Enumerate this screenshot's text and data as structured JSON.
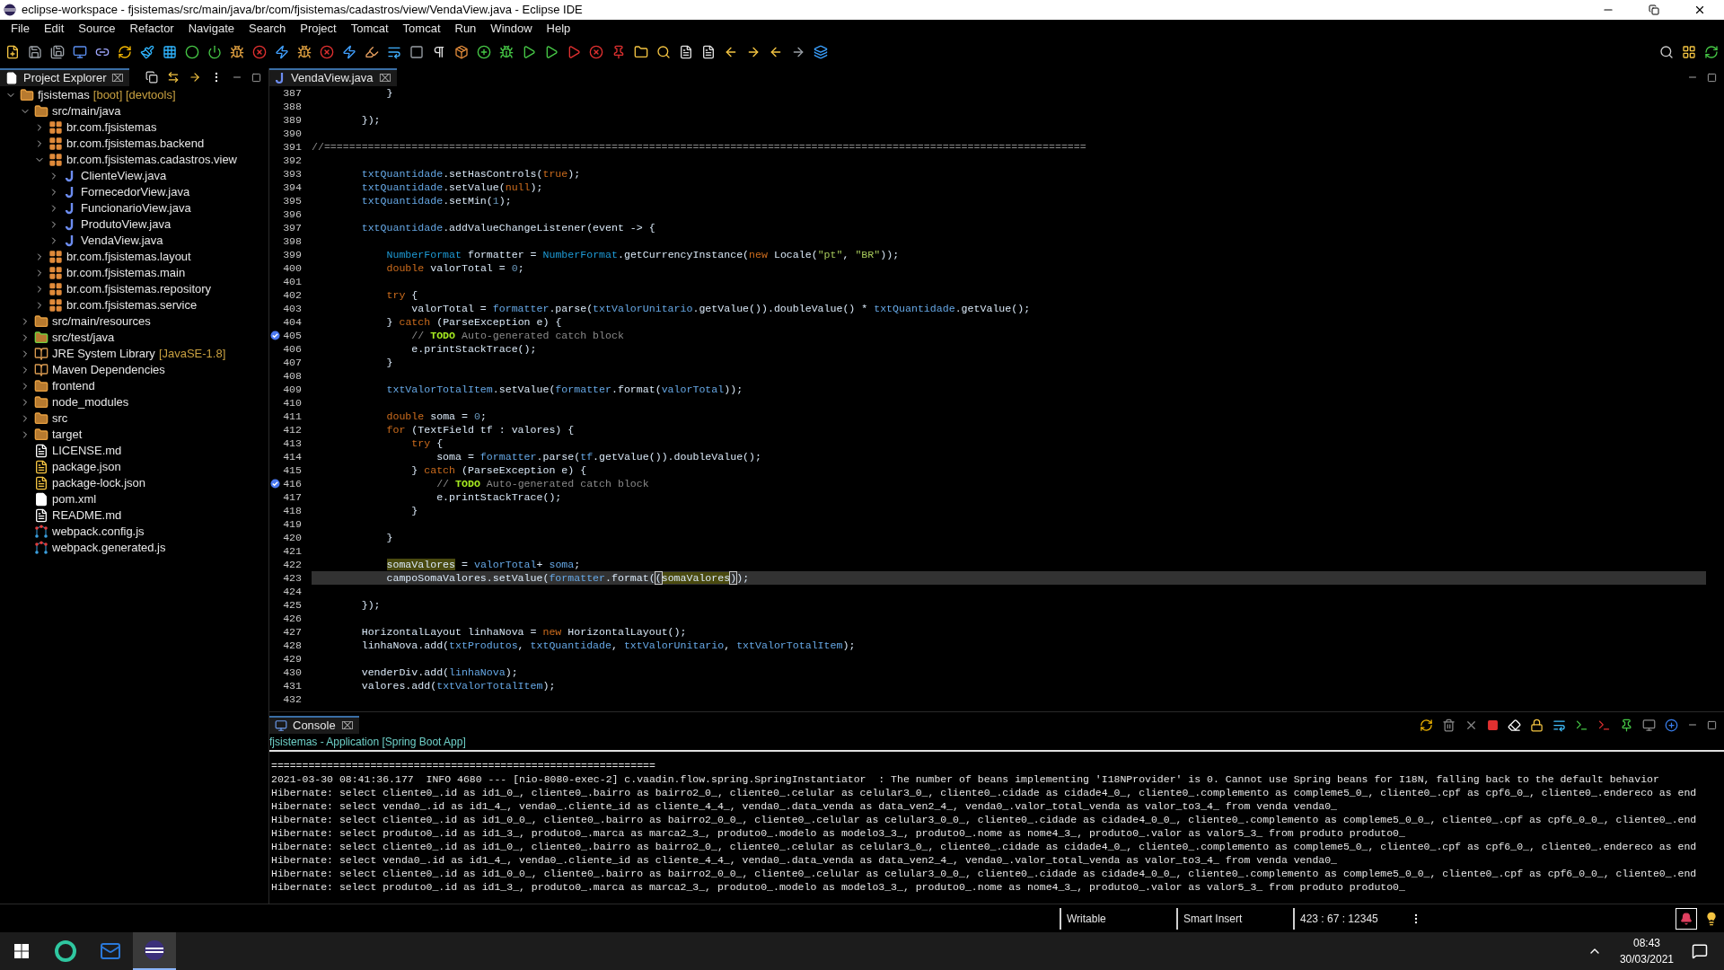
{
  "window": {
    "title": "eclipse-workspace - fjsistemas/src/main/java/br/com/fjsistemas/cadastros/view/VendaView.java - Eclipse IDE"
  },
  "menu": [
    "File",
    "Edit",
    "Source",
    "Refactor",
    "Navigate",
    "Search",
    "Project",
    "Tomcat",
    "Tomcat",
    "Run",
    "Window",
    "Help"
  ],
  "project_explorer": {
    "tab": {
      "label": "Project Explorer",
      "selected": true,
      "close": "⌧"
    },
    "tree": [
      {
        "kind": "project",
        "label": "fjsistemas",
        "decoration": "[boot] [devtools]",
        "expanded": true,
        "children": [
          {
            "kind": "source-folder",
            "label": "src/main/java",
            "expanded": true,
            "children": [
              {
                "kind": "package",
                "label": "br.com.fjsistemas",
                "expanded": false
              },
              {
                "kind": "package",
                "label": "br.com.fjsistemas.backend",
                "expanded": false
              },
              {
                "kind": "package",
                "label": "br.com.fjsistemas.cadastros.view",
                "expanded": true,
                "children": [
                  {
                    "kind": "java",
                    "label": "ClienteView.java",
                    "expanded": false
                  },
                  {
                    "kind": "java",
                    "label": "FornecedorView.java",
                    "expanded": false
                  },
                  {
                    "kind": "java",
                    "label": "FuncionarioView.java",
                    "expanded": false
                  },
                  {
                    "kind": "java",
                    "label": "ProdutoView.java",
                    "expanded": false
                  },
                  {
                    "kind": "java",
                    "label": "VendaView.java",
                    "expanded": false
                  }
                ]
              },
              {
                "kind": "package",
                "label": "br.com.fjsistemas.layout",
                "expanded": false
              },
              {
                "kind": "package",
                "label": "br.com.fjsistemas.main",
                "expanded": false
              },
              {
                "kind": "package",
                "label": "br.com.fjsistemas.repository",
                "expanded": false
              },
              {
                "kind": "package",
                "label": "br.com.fjsistemas.service",
                "expanded": false
              }
            ]
          },
          {
            "kind": "source-folder",
            "label": "src/main/resources",
            "expanded": false
          },
          {
            "kind": "test-folder",
            "label": "src/test/java",
            "expanded": false
          },
          {
            "kind": "library",
            "label": "JRE System Library",
            "decoration": "[JavaSE-1.8]",
            "expanded": false
          },
          {
            "kind": "library",
            "label": "Maven Dependencies",
            "expanded": false
          },
          {
            "kind": "folder",
            "label": "frontend",
            "expanded": false
          },
          {
            "kind": "folder",
            "label": "node_modules",
            "expanded": false
          },
          {
            "kind": "folder",
            "label": "src",
            "expanded": false
          },
          {
            "kind": "folder",
            "label": "target",
            "expanded": false
          },
          {
            "kind": "file",
            "label": "LICENSE.md"
          },
          {
            "kind": "json",
            "label": "package.json"
          },
          {
            "kind": "json",
            "label": "package-lock.json"
          },
          {
            "kind": "pom",
            "label": "pom.xml"
          },
          {
            "kind": "file",
            "label": "README.md"
          },
          {
            "kind": "webpack",
            "label": "webpack.config.js"
          },
          {
            "kind": "webpack",
            "label": "webpack.generated.js"
          }
        ]
      }
    ]
  },
  "editor": {
    "tab": {
      "label": "VendaView.java",
      "selected": true,
      "close": "⌧"
    },
    "lines": [
      {
        "number": "387",
        "kind": "code",
        "segments": [
          {
            "kind": "plain",
            "text": "            }"
          }
        ]
      },
      {
        "number": "388",
        "kind": "code"
      },
      {
        "number": "389",
        "kind": "code",
        "segments": [
          {
            "kind": "plain",
            "text": "        });"
          }
        ]
      },
      {
        "number": "390",
        "kind": "code"
      },
      {
        "number": "391",
        "kind": "code",
        "segments": [
          {
            "kind": "comment",
            "text": "//=========================================================================================================================="
          }
        ]
      },
      {
        "number": "392",
        "kind": "code"
      },
      {
        "number": "393",
        "kind": "code",
        "segments": [
          {
            "kind": "field",
            "text": "        txtQuantidade"
          },
          {
            "kind": "plain",
            "text": ".setHasControls("
          },
          {
            "kind": "keyword",
            "text": "true"
          },
          {
            "kind": "plain",
            "text": ");"
          }
        ]
      },
      {
        "number": "394",
        "kind": "code",
        "segments": [
          {
            "kind": "field",
            "text": "        txtQuantidade"
          },
          {
            "kind": "plain",
            "text": ".setValue("
          },
          {
            "kind": "keyword",
            "text": "null"
          },
          {
            "kind": "plain",
            "text": ");"
          }
        ]
      },
      {
        "number": "395",
        "kind": "code",
        "segments": [
          {
            "kind": "field",
            "text": "        txtQuantidade"
          },
          {
            "kind": "plain",
            "text": ".setMin("
          },
          {
            "kind": "number",
            "text": "1"
          },
          {
            "kind": "plain",
            "text": ");"
          }
        ]
      },
      {
        "number": "396",
        "kind": "code"
      },
      {
        "number": "397",
        "kind": "code",
        "segments": [
          {
            "kind": "field",
            "text": "        txtQuantidade"
          },
          {
            "kind": "plain",
            "text": ".addValueChangeListener(event -> {"
          }
        ]
      },
      {
        "number": "398",
        "kind": "code"
      },
      {
        "number": "399",
        "kind": "code",
        "segments": [
          {
            "kind": "type",
            "text": "            NumberFormat"
          },
          {
            "kind": "plain",
            "text": " formatter = "
          },
          {
            "kind": "type",
            "text": "NumberFormat"
          },
          {
            "kind": "plain",
            "text": ".getCurrencyInstance("
          },
          {
            "kind": "keyword",
            "text": "new"
          },
          {
            "kind": "plain",
            "text": " Locale("
          },
          {
            "kind": "string",
            "text": "\"pt\""
          },
          {
            "kind": "plain",
            "text": ", "
          },
          {
            "kind": "string",
            "text": "\"BR\""
          },
          {
            "kind": "plain",
            "text": "));"
          }
        ]
      },
      {
        "number": "400",
        "kind": "code",
        "segments": [
          {
            "kind": "keyword",
            "text": "            double"
          },
          {
            "kind": "plain",
            "text": " valorTotal = "
          },
          {
            "kind": "number",
            "text": "0"
          },
          {
            "kind": "plain",
            "text": ";"
          }
        ]
      },
      {
        "number": "401",
        "kind": "code"
      },
      {
        "number": "402",
        "kind": "code",
        "segments": [
          {
            "kind": "keyword",
            "text": "            try"
          },
          {
            "kind": "plain",
            "text": " {"
          }
        ]
      },
      {
        "number": "403",
        "kind": "code",
        "segments": [
          {
            "kind": "plain",
            "text": "                valorTotal = "
          },
          {
            "kind": "field",
            "text": "formatter"
          },
          {
            "kind": "plain",
            "text": ".parse("
          },
          {
            "kind": "field",
            "text": "txtValorUnitario"
          },
          {
            "kind": "plain",
            "text": ".getValue()).doubleValue() * "
          },
          {
            "kind": "field",
            "text": "txtQuantidade"
          },
          {
            "kind": "plain",
            "text": ".getValue();"
          }
        ]
      },
      {
        "number": "404",
        "kind": "code",
        "segments": [
          {
            "kind": "plain",
            "text": "            } "
          },
          {
            "kind": "keyword",
            "text": "catch"
          },
          {
            "kind": "plain",
            "text": " (ParseException e) {"
          }
        ]
      },
      {
        "number": "405",
        "kind": "task",
        "segments": [
          {
            "kind": "comment",
            "text": "                // "
          },
          {
            "kind": "todo",
            "text": "TODO"
          },
          {
            "kind": "comment",
            "text": " Auto-generated catch block"
          }
        ]
      },
      {
        "number": "406",
        "kind": "code",
        "segments": [
          {
            "kind": "plain",
            "text": "                e.printStackTrace();"
          }
        ]
      },
      {
        "number": "407",
        "kind": "code",
        "segments": [
          {
            "kind": "plain",
            "text": "            }"
          }
        ]
      },
      {
        "number": "408",
        "kind": "code"
      },
      {
        "number": "409",
        "kind": "code",
        "segments": [
          {
            "kind": "field",
            "text": "            txtValorTotalItem"
          },
          {
            "kind": "plain",
            "text": ".setValue("
          },
          {
            "kind": "field",
            "text": "formatter"
          },
          {
            "kind": "plain",
            "text": ".format("
          },
          {
            "kind": "field",
            "text": "valorTotal"
          },
          {
            "kind": "plain",
            "text": "));"
          }
        ]
      },
      {
        "number": "410",
        "kind": "code"
      },
      {
        "number": "411",
        "kind": "code",
        "segments": [
          {
            "kind": "keyword",
            "text": "            double"
          },
          {
            "kind": "plain",
            "text": " soma = "
          },
          {
            "kind": "number",
            "text": "0"
          },
          {
            "kind": "plain",
            "text": ";"
          }
        ]
      },
      {
        "number": "412",
        "kind": "code",
        "segments": [
          {
            "kind": "keyword",
            "text": "            for"
          },
          {
            "kind": "plain",
            "text": " (TextField tf : valores) {"
          }
        ]
      },
      {
        "number": "413",
        "kind": "code",
        "segments": [
          {
            "kind": "keyword",
            "text": "                try"
          },
          {
            "kind": "plain",
            "text": " {"
          }
        ]
      },
      {
        "number": "414",
        "kind": "code",
        "segments": [
          {
            "kind": "plain",
            "text": "                    soma = "
          },
          {
            "kind": "field",
            "text": "formatter"
          },
          {
            "kind": "plain",
            "text": ".parse("
          },
          {
            "kind": "field",
            "text": "tf"
          },
          {
            "kind": "plain",
            "text": ".getValue()).doubleValue();"
          }
        ]
      },
      {
        "number": "415",
        "kind": "code",
        "segments": [
          {
            "kind": "plain",
            "text": "                } "
          },
          {
            "kind": "keyword",
            "text": "catch"
          },
          {
            "kind": "plain",
            "text": " (ParseException e) {"
          }
        ]
      },
      {
        "number": "416",
        "kind": "task",
        "segments": [
          {
            "kind": "comment",
            "text": "                    // "
          },
          {
            "kind": "todo",
            "text": "TODO"
          },
          {
            "kind": "comment",
            "text": " Auto-generated catch block"
          }
        ]
      },
      {
        "number": "417",
        "kind": "code",
        "segments": [
          {
            "kind": "plain",
            "text": "                    e.printStackTrace();"
          }
        ]
      },
      {
        "number": "418",
        "kind": "code",
        "segments": [
          {
            "kind": "plain",
            "text": "                }"
          }
        ]
      },
      {
        "number": "419",
        "kind": "code"
      },
      {
        "number": "420",
        "kind": "code",
        "segments": [
          {
            "kind": "plain",
            "text": "            }"
          }
        ]
      },
      {
        "number": "421",
        "kind": "code"
      },
      {
        "number": "422",
        "kind": "code",
        "segments": [
          {
            "kind": "occurrence",
            "text": "            somaValores"
          },
          {
            "kind": "plain",
            "text": " = "
          },
          {
            "kind": "field",
            "text": "valorTotal"
          },
          {
            "kind": "plain",
            "text": "+ "
          },
          {
            "kind": "field",
            "text": "soma"
          },
          {
            "kind": "plain",
            "text": ";"
          }
        ]
      },
      {
        "number": "423",
        "kind": "current",
        "segments": [
          {
            "kind": "plain",
            "text": "            campoSomaValores.setValue("
          },
          {
            "kind": "field",
            "text": "formatter"
          },
          {
            "kind": "plain",
            "text": ".format("
          },
          {
            "kind": "bracket",
            "text": "("
          },
          {
            "kind": "occurrence",
            "text": "somaValores"
          },
          {
            "kind": "bracket",
            "text": ")"
          },
          {
            "kind": "plain",
            "text": ");"
          }
        ]
      },
      {
        "number": "424",
        "kind": "code"
      },
      {
        "number": "425",
        "kind": "code",
        "segments": [
          {
            "kind": "plain",
            "text": "        });"
          }
        ]
      },
      {
        "number": "426",
        "kind": "code"
      },
      {
        "number": "427",
        "kind": "code",
        "segments": [
          {
            "kind": "plain",
            "text": "        HorizontalLayout linhaNova = "
          },
          {
            "kind": "keyword",
            "text": "new"
          },
          {
            "kind": "plain",
            "text": " HorizontalLayout();"
          }
        ]
      },
      {
        "number": "428",
        "kind": "code",
        "segments": [
          {
            "kind": "plain",
            "text": "        linhaNova.add("
          },
          {
            "kind": "field",
            "text": "txtProdutos"
          },
          {
            "kind": "plain",
            "text": ", "
          },
          {
            "kind": "field",
            "text": "txtQuantidade"
          },
          {
            "kind": "plain",
            "text": ", "
          },
          {
            "kind": "field",
            "text": "txtValorUnitario"
          },
          {
            "kind": "plain",
            "text": ", "
          },
          {
            "kind": "field",
            "text": "txtValorTotalItem"
          },
          {
            "kind": "plain",
            "text": ");"
          }
        ]
      },
      {
        "number": "429",
        "kind": "code"
      },
      {
        "number": "430",
        "kind": "code",
        "segments": [
          {
            "kind": "plain",
            "text": "        venderDiv.add("
          },
          {
            "kind": "field",
            "text": "linhaNova"
          },
          {
            "kind": "plain",
            "text": ");"
          }
        ]
      },
      {
        "number": "431",
        "kind": "code",
        "segments": [
          {
            "kind": "plain",
            "text": "        valores.add("
          },
          {
            "kind": "field",
            "text": "txtValorTotalItem"
          },
          {
            "kind": "plain",
            "text": ");"
          }
        ]
      },
      {
        "number": "432",
        "kind": "code"
      }
    ]
  },
  "console": {
    "tab": {
      "label": "Console",
      "selected": true,
      "close": "⌧"
    },
    "subtitle": "fjsistemas - Application [Spring Boot App]",
    "lines": [
      "==============================================================",
      "2021-03-30 08:41:36.177  INFO 4680 --- [nio-8080-exec-2] c.vaadin.flow.spring.SpringInstantiator  : The number of beans implementing 'I18NProvider' is 0. Cannot use Spring beans for I18N, falling back to the default behavior",
      "Hibernate: select cliente0_.id as id1_0_, cliente0_.bairro as bairro2_0_, cliente0_.celular as celular3_0_, cliente0_.cidade as cidade4_0_, cliente0_.complemento as compleme5_0_, cliente0_.cpf as cpf6_0_, cliente0_.endereco as end",
      "Hibernate: select venda0_.id as id1_4_, venda0_.cliente_id as cliente_4_4_, venda0_.data_venda as data_ven2_4_, venda0_.valor_total_venda as valor_to3_4_ from venda venda0_",
      "Hibernate: select cliente0_.id as id1_0_0_, cliente0_.bairro as bairro2_0_0_, cliente0_.celular as celular3_0_0_, cliente0_.cidade as cidade4_0_0_, cliente0_.complemento as compleme5_0_0_, cliente0_.cpf as cpf6_0_0_, cliente0_.end",
      "Hibernate: select produto0_.id as id1_3_, produto0_.marca as marca2_3_, produto0_.modelo as modelo3_3_, produto0_.nome as nome4_3_, produto0_.valor as valor5_3_ from produto produto0_",
      "Hibernate: select cliente0_.id as id1_0_, cliente0_.bairro as bairro2_0_, cliente0_.celular as celular3_0_, cliente0_.cidade as cidade4_0_, cliente0_.complemento as compleme5_0_, cliente0_.cpf as cpf6_0_, cliente0_.endereco as end",
      "Hibernate: select venda0_.id as id1_4_, venda0_.cliente_id as cliente_4_4_, venda0_.data_venda as data_ven2_4_, venda0_.valor_total_venda as valor_to3_4_ from venda venda0_",
      "Hibernate: select cliente0_.id as id1_0_0_, cliente0_.bairro as bairro2_0_0_, cliente0_.celular as celular3_0_0_, cliente0_.cidade as cidade4_0_0_, cliente0_.complemento as compleme5_0_0_, cliente0_.cpf as cpf6_0_0_, cliente0_.end",
      "Hibernate: select produto0_.id as id1_3_, produto0_.marca as marca2_3_, produto0_.modelo as modelo3_3_, produto0_.nome as nome4_3_, produto0_.valor as valor5_3_ from produto produto0_"
    ]
  },
  "status_bar": {
    "fields": [
      "Writable",
      "Smart Insert",
      "423 : 67 : 12345"
    ]
  },
  "taskbar": {
    "time": "08:43",
    "date": "30/03/2021"
  }
}
